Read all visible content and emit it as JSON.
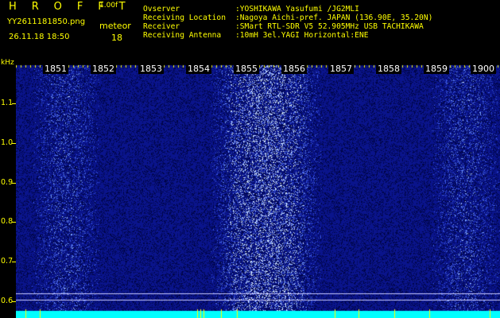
{
  "header": {
    "title": "H R O F F T",
    "version": "1.00f",
    "filename": "YY2611181850.png",
    "meteor_label": "meteor",
    "datetime": "26.11.18 18:50",
    "meteor_count": "18"
  },
  "info": [
    {
      "key": "Ovserver",
      "value": ":YOSHIKAWA Yasufumi /JG2MLI"
    },
    {
      "key": "Receiving Location",
      "value": ":Nagoya Aichi-pref. JAPAN (136.90E, 35.20N)"
    },
    {
      "key": "Receiver",
      "value": ":SMart RTL-SDR V5 52.905MHz USB TACHIKAWA"
    },
    {
      "key": "Receiving Antenna",
      "value": ":10mH 3el.YAGI Horizontal:ENE"
    }
  ],
  "y_axis": {
    "unit": "kHz",
    "labels": [
      "1.1",
      "1.0",
      "0.9",
      "0.8",
      "0.7",
      "0.6"
    ]
  },
  "time_labels": [
    "1851",
    "1852",
    "1853",
    "1854",
    "1855",
    "1856",
    "1857",
    "1858",
    "1859",
    "1900"
  ],
  "colors": {
    "label_yellow": "#ffff00",
    "background_blue": "#0a1aa0",
    "bottom_band": "#00ffff",
    "time_label": "#ffffff"
  }
}
